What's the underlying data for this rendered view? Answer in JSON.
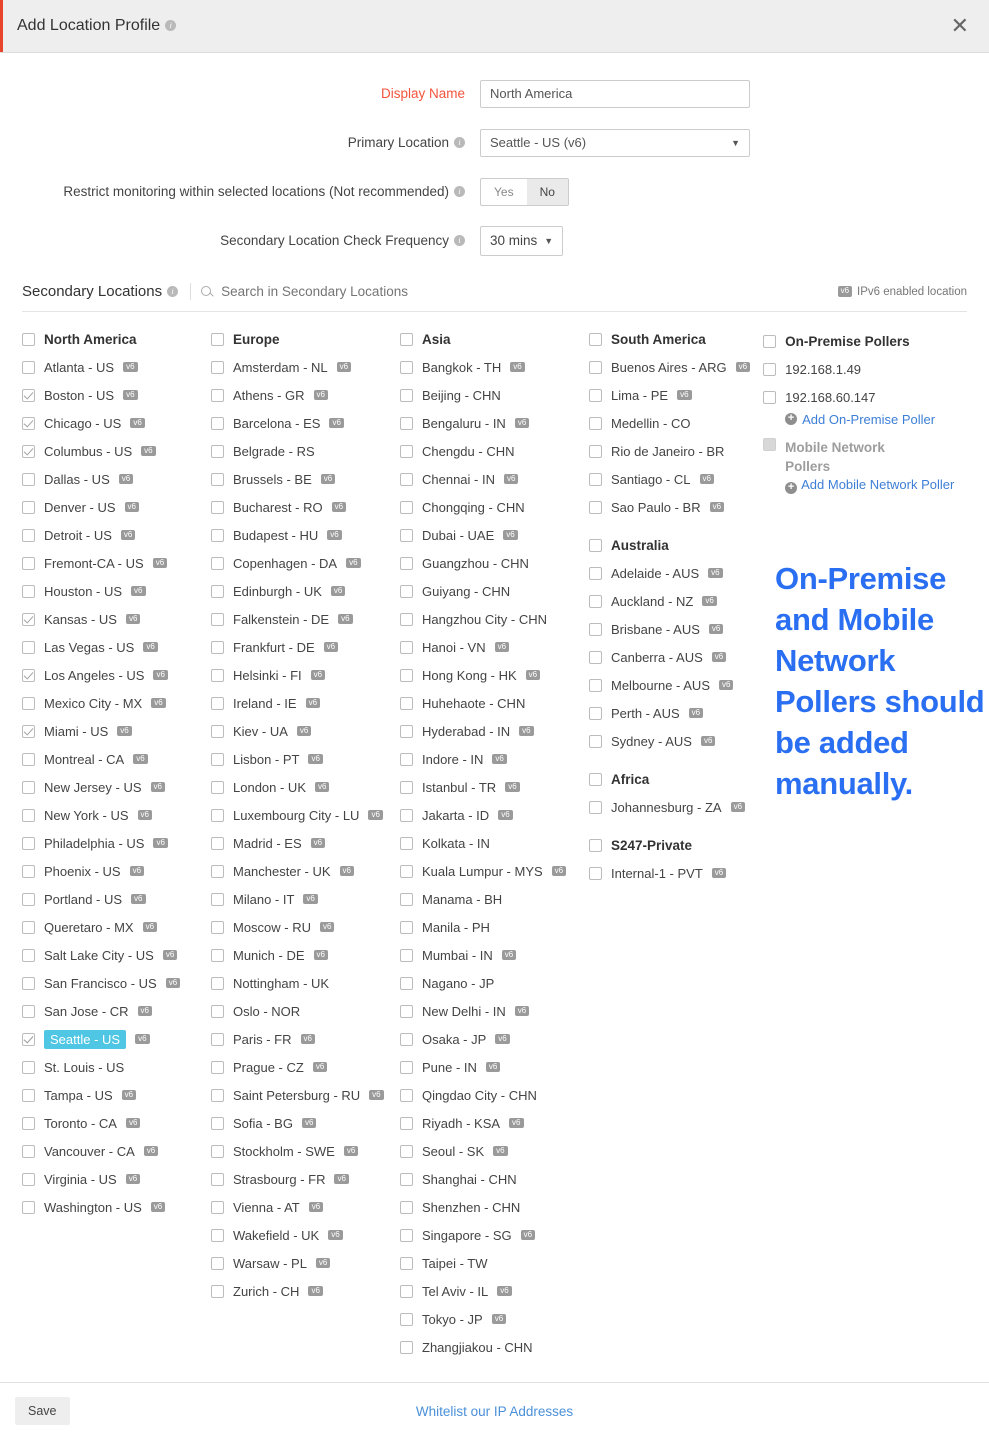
{
  "header": {
    "title": "Add Location Profile",
    "info_icon": "info-icon",
    "close_icon": "close-icon"
  },
  "form": {
    "display_name": {
      "label": "Display Name",
      "value": "North America",
      "placeholder": ""
    },
    "primary_location": {
      "label": "Primary Location",
      "value": "Seattle - US (v6)"
    },
    "restrict": {
      "label": "Restrict monitoring within selected locations (Not recommended)",
      "yes": "Yes",
      "no": "No",
      "selected": "No"
    },
    "frequency": {
      "label": "Secondary Location Check Frequency",
      "value": "30 mins"
    }
  },
  "secondary": {
    "title": "Secondary Locations",
    "search_placeholder": "Search in Secondary Locations",
    "ipv6_note": "IPv6 enabled location",
    "v6_badge": "v6"
  },
  "columns": [
    {
      "groups": [
        {
          "name": "North America",
          "checked": false,
          "items": [
            {
              "label": "Atlanta - US",
              "v6": true,
              "checked": false
            },
            {
              "label": "Boston - US",
              "v6": true,
              "checked": true
            },
            {
              "label": "Chicago - US",
              "v6": true,
              "checked": true
            },
            {
              "label": "Columbus - US",
              "v6": true,
              "checked": true
            },
            {
              "label": "Dallas - US",
              "v6": true,
              "checked": false
            },
            {
              "label": "Denver - US",
              "v6": true,
              "checked": false
            },
            {
              "label": "Detroit - US",
              "v6": true,
              "checked": false
            },
            {
              "label": "Fremont-CA - US",
              "v6": true,
              "checked": false
            },
            {
              "label": "Houston - US",
              "v6": true,
              "checked": false
            },
            {
              "label": "Kansas - US",
              "v6": true,
              "checked": true
            },
            {
              "label": "Las Vegas - US",
              "v6": true,
              "checked": false
            },
            {
              "label": "Los Angeles - US",
              "v6": true,
              "checked": true
            },
            {
              "label": "Mexico City - MX",
              "v6": true,
              "checked": false
            },
            {
              "label": "Miami - US",
              "v6": true,
              "checked": true
            },
            {
              "label": "Montreal - CA",
              "v6": true,
              "checked": false
            },
            {
              "label": "New Jersey - US",
              "v6": true,
              "checked": false
            },
            {
              "label": "New York - US",
              "v6": true,
              "checked": false
            },
            {
              "label": "Philadelphia - US",
              "v6": true,
              "checked": false
            },
            {
              "label": "Phoenix - US",
              "v6": true,
              "checked": false
            },
            {
              "label": "Portland - US",
              "v6": true,
              "checked": false
            },
            {
              "label": "Queretaro - MX",
              "v6": true,
              "checked": false
            },
            {
              "label": "Salt Lake City - US",
              "v6": true,
              "checked": false
            },
            {
              "label": "San Francisco - US",
              "v6": true,
              "checked": false
            },
            {
              "label": "San Jose - CR",
              "v6": true,
              "checked": false
            },
            {
              "label": "Seattle - US",
              "v6": true,
              "checked": true,
              "selected": true
            },
            {
              "label": "St. Louis - US",
              "v6": false,
              "checked": false
            },
            {
              "label": "Tampa - US",
              "v6": true,
              "checked": false
            },
            {
              "label": "Toronto - CA",
              "v6": true,
              "checked": false
            },
            {
              "label": "Vancouver - CA",
              "v6": true,
              "checked": false
            },
            {
              "label": "Virginia - US",
              "v6": true,
              "checked": false
            },
            {
              "label": "Washington - US",
              "v6": true,
              "checked": false
            }
          ]
        }
      ]
    },
    {
      "groups": [
        {
          "name": "Europe",
          "checked": false,
          "items": [
            {
              "label": "Amsterdam - NL",
              "v6": true,
              "checked": false
            },
            {
              "label": "Athens - GR",
              "v6": true,
              "checked": false
            },
            {
              "label": "Barcelona - ES",
              "v6": true,
              "checked": false
            },
            {
              "label": "Belgrade - RS",
              "v6": false,
              "checked": false
            },
            {
              "label": "Brussels - BE",
              "v6": true,
              "checked": false
            },
            {
              "label": "Bucharest - RO",
              "v6": true,
              "checked": false
            },
            {
              "label": "Budapest - HU",
              "v6": true,
              "checked": false
            },
            {
              "label": "Copenhagen - DA",
              "v6": true,
              "checked": false
            },
            {
              "label": "Edinburgh - UK",
              "v6": true,
              "checked": false
            },
            {
              "label": "Falkenstein - DE",
              "v6": true,
              "checked": false
            },
            {
              "label": "Frankfurt - DE",
              "v6": true,
              "checked": false
            },
            {
              "label": "Helsinki - FI",
              "v6": true,
              "checked": false
            },
            {
              "label": "Ireland - IE",
              "v6": true,
              "checked": false
            },
            {
              "label": "Kiev - UA",
              "v6": true,
              "checked": false
            },
            {
              "label": "Lisbon - PT",
              "v6": true,
              "checked": false
            },
            {
              "label": "London - UK",
              "v6": true,
              "checked": false
            },
            {
              "label": "Luxembourg City - LU",
              "v6": true,
              "checked": false
            },
            {
              "label": "Madrid - ES",
              "v6": true,
              "checked": false
            },
            {
              "label": "Manchester - UK",
              "v6": true,
              "checked": false
            },
            {
              "label": "Milano - IT",
              "v6": true,
              "checked": false
            },
            {
              "label": "Moscow - RU",
              "v6": true,
              "checked": false
            },
            {
              "label": "Munich - DE",
              "v6": true,
              "checked": false
            },
            {
              "label": "Nottingham - UK",
              "v6": false,
              "checked": false
            },
            {
              "label": "Oslo - NOR",
              "v6": false,
              "checked": false
            },
            {
              "label": "Paris - FR",
              "v6": true,
              "checked": false
            },
            {
              "label": "Prague - CZ",
              "v6": true,
              "checked": false
            },
            {
              "label": "Saint Petersburg - RU",
              "v6": true,
              "checked": false
            },
            {
              "label": "Sofia - BG",
              "v6": true,
              "checked": false
            },
            {
              "label": "Stockholm - SWE",
              "v6": true,
              "checked": false
            },
            {
              "label": "Strasbourg - FR",
              "v6": true,
              "checked": false
            },
            {
              "label": "Vienna - AT",
              "v6": true,
              "checked": false
            },
            {
              "label": "Wakefield - UK",
              "v6": true,
              "checked": false
            },
            {
              "label": "Warsaw - PL",
              "v6": true,
              "checked": false
            },
            {
              "label": "Zurich - CH",
              "v6": true,
              "checked": false
            }
          ]
        }
      ]
    },
    {
      "groups": [
        {
          "name": "Asia",
          "checked": false,
          "items": [
            {
              "label": "Bangkok - TH",
              "v6": true,
              "checked": false
            },
            {
              "label": "Beijing - CHN",
              "v6": false,
              "checked": false
            },
            {
              "label": "Bengaluru - IN",
              "v6": true,
              "checked": false
            },
            {
              "label": "Chengdu - CHN",
              "v6": false,
              "checked": false
            },
            {
              "label": "Chennai - IN",
              "v6": true,
              "checked": false
            },
            {
              "label": "Chongqing - CHN",
              "v6": false,
              "checked": false
            },
            {
              "label": "Dubai - UAE",
              "v6": true,
              "checked": false
            },
            {
              "label": "Guangzhou - CHN",
              "v6": false,
              "checked": false
            },
            {
              "label": "Guiyang - CHN",
              "v6": false,
              "checked": false
            },
            {
              "label": "Hangzhou City - CHN",
              "v6": false,
              "checked": false
            },
            {
              "label": "Hanoi - VN",
              "v6": true,
              "checked": false
            },
            {
              "label": "Hong Kong - HK",
              "v6": true,
              "checked": false
            },
            {
              "label": "Huhehaote - CHN",
              "v6": false,
              "checked": false
            },
            {
              "label": "Hyderabad - IN",
              "v6": true,
              "checked": false
            },
            {
              "label": "Indore - IN",
              "v6": true,
              "checked": false
            },
            {
              "label": "Istanbul - TR",
              "v6": true,
              "checked": false
            },
            {
              "label": "Jakarta - ID",
              "v6": true,
              "checked": false
            },
            {
              "label": "Kolkata - IN",
              "v6": false,
              "checked": false
            },
            {
              "label": "Kuala Lumpur - MYS",
              "v6": true,
              "checked": false
            },
            {
              "label": "Manama - BH",
              "v6": false,
              "checked": false
            },
            {
              "label": "Manila - PH",
              "v6": false,
              "checked": false
            },
            {
              "label": "Mumbai - IN",
              "v6": true,
              "checked": false
            },
            {
              "label": "Nagano - JP",
              "v6": false,
              "checked": false
            },
            {
              "label": "New Delhi - IN",
              "v6": true,
              "checked": false
            },
            {
              "label": "Osaka - JP",
              "v6": true,
              "checked": false
            },
            {
              "label": "Pune - IN",
              "v6": true,
              "checked": false
            },
            {
              "label": "Qingdao City - CHN",
              "v6": false,
              "checked": false
            },
            {
              "label": "Riyadh - KSA",
              "v6": true,
              "checked": false
            },
            {
              "label": "Seoul - SK",
              "v6": true,
              "checked": false
            },
            {
              "label": "Shanghai - CHN",
              "v6": false,
              "checked": false
            },
            {
              "label": "Shenzhen - CHN",
              "v6": false,
              "checked": false
            },
            {
              "label": "Singapore - SG",
              "v6": true,
              "checked": false
            },
            {
              "label": "Taipei - TW",
              "v6": false,
              "checked": false
            },
            {
              "label": "Tel Aviv - IL",
              "v6": true,
              "checked": false
            },
            {
              "label": "Tokyo - JP",
              "v6": true,
              "checked": false
            },
            {
              "label": "Zhangjiakou - CHN",
              "v6": false,
              "checked": false
            }
          ]
        }
      ]
    },
    {
      "groups": [
        {
          "name": "South America",
          "checked": false,
          "items": [
            {
              "label": "Buenos Aires - ARG",
              "v6": true,
              "checked": false
            },
            {
              "label": "Lima - PE",
              "v6": true,
              "checked": false
            },
            {
              "label": "Medellin - CO",
              "v6": false,
              "checked": false
            },
            {
              "label": "Rio de Janeiro - BR",
              "v6": false,
              "checked": false
            },
            {
              "label": "Santiago - CL",
              "v6": true,
              "checked": false
            },
            {
              "label": "Sao Paulo - BR",
              "v6": true,
              "checked": false
            }
          ]
        },
        {
          "name": "Australia",
          "checked": false,
          "items": [
            {
              "label": "Adelaide - AUS",
              "v6": true,
              "checked": false
            },
            {
              "label": "Auckland - NZ",
              "v6": true,
              "checked": false
            },
            {
              "label": "Brisbane - AUS",
              "v6": true,
              "checked": false
            },
            {
              "label": "Canberra - AUS",
              "v6": true,
              "checked": false
            },
            {
              "label": "Melbourne - AUS",
              "v6": true,
              "checked": false
            },
            {
              "label": "Perth - AUS",
              "v6": true,
              "checked": false
            },
            {
              "label": "Sydney - AUS",
              "v6": true,
              "checked": false
            }
          ]
        },
        {
          "name": "Africa",
          "checked": false,
          "items": [
            {
              "label": "Johannesburg - ZA",
              "v6": true,
              "checked": false
            }
          ]
        },
        {
          "name": "S247-Private",
          "checked": false,
          "items": [
            {
              "label": "Internal-1 - PVT",
              "v6": true,
              "checked": false
            }
          ]
        }
      ]
    }
  ],
  "pollers": {
    "onpremise": {
      "title": "On-Premise Pollers",
      "checked": false,
      "items": [
        {
          "label": "192.168.1.49",
          "checked": false
        },
        {
          "label": "192.168.60.147",
          "checked": false
        }
      ],
      "add_label": "Add On-Premise Poller"
    },
    "mobile": {
      "title": "Mobile Network Pollers",
      "disabled": true,
      "add_label": "Add Mobile Network Poller"
    },
    "highlight_color": "#2a6ff2"
  },
  "annotation": {
    "text": "On-Premise and Mobile Network Pollers should be added manually.",
    "color": "#2a6ff2"
  },
  "footer": {
    "save_label": "Save",
    "whitelist_label": "Whitelist our IP Addresses"
  }
}
